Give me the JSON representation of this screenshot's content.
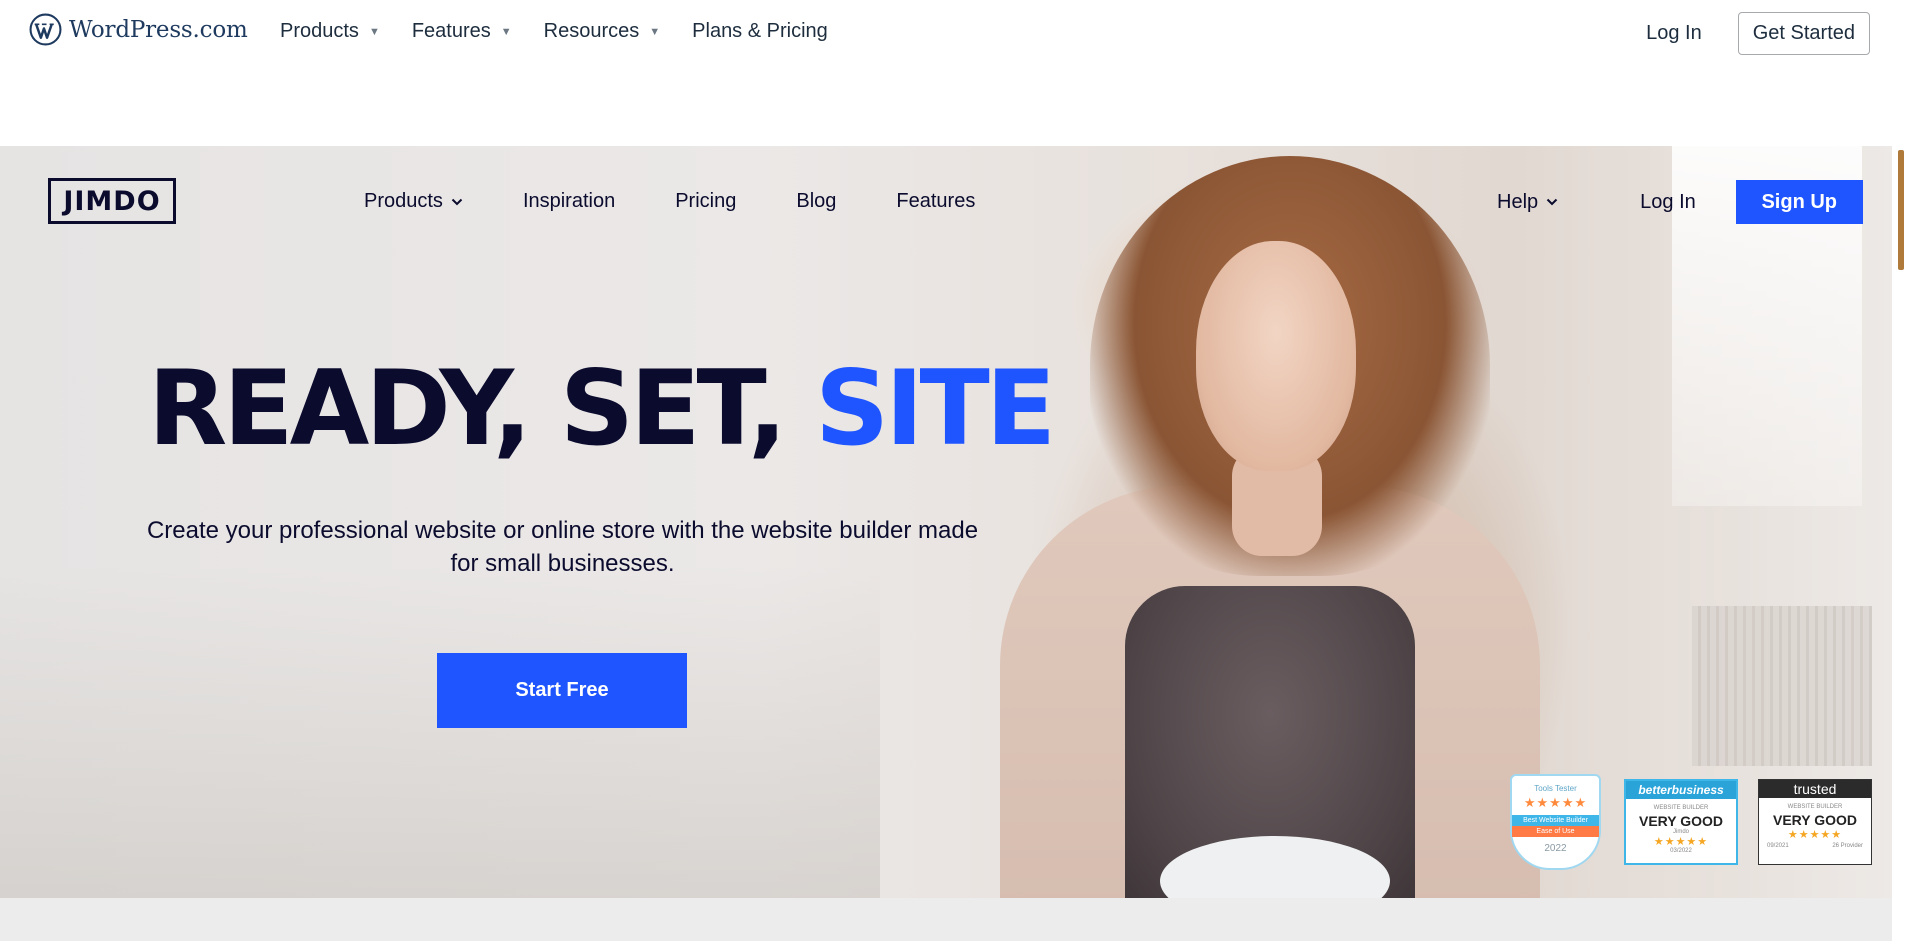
{
  "wordpress_bar": {
    "logo_text": "WordPress.com",
    "nav": [
      {
        "label": "Products",
        "dropdown": true
      },
      {
        "label": "Features",
        "dropdown": true
      },
      {
        "label": "Resources",
        "dropdown": true
      },
      {
        "label": "Plans & Pricing",
        "dropdown": false
      }
    ],
    "login_label": "Log In",
    "get_started_label": "Get Started"
  },
  "jimdo": {
    "logo_text": "JIMDO",
    "nav": [
      {
        "label": "Products",
        "dropdown": true
      },
      {
        "label": "Inspiration"
      },
      {
        "label": "Pricing"
      },
      {
        "label": "Blog"
      },
      {
        "label": "Features"
      }
    ],
    "help_label": "Help",
    "login_label": "Log In",
    "signup_label": "Sign Up",
    "headline_part1": "READY, SET, ",
    "headline_accent": "SITE",
    "subhead": "Create your professional website or online store with the website builder made for small businesses.",
    "cta_label": "Start Free",
    "accent_color": "#1f55ff",
    "text_color": "#0b0b2e",
    "badges": [
      {
        "brand": "Tools Tester",
        "stars": "★★★★★",
        "line1": "Best Website Builder",
        "line2": "Ease of Use",
        "year": "2022"
      },
      {
        "brand": "betterbusiness",
        "sub": "WEBSITE BUILDER",
        "grade": "VERY GOOD",
        "name": "Jimdo",
        "stars": "★★★★★",
        "date": "03/2022"
      },
      {
        "brand": "trusted",
        "sub": "WEBSITE BUILDER",
        "grade": "VERY GOOD",
        "stars": "★★★★★",
        "date": "09/2021",
        "note": "26 Provider"
      }
    ]
  }
}
